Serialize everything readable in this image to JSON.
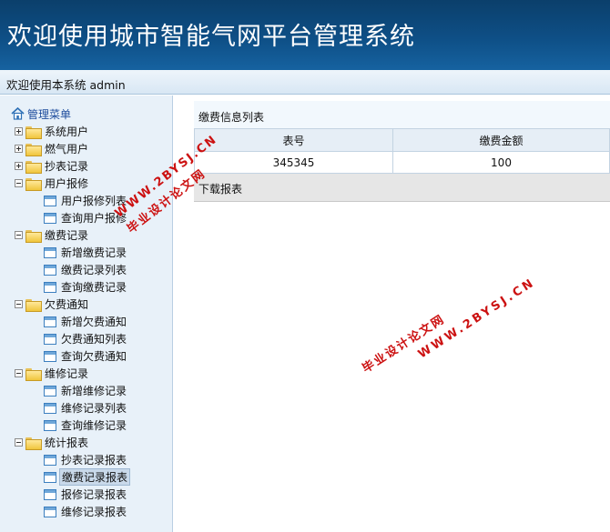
{
  "header": {
    "title": "欢迎使用城市智能气网平台管理系统"
  },
  "userbar": {
    "text": "欢迎使用本系统  admin"
  },
  "sidebar": {
    "root_label": "管理菜单",
    "items": [
      {
        "type": "group",
        "label": "系统用户",
        "expanded": false
      },
      {
        "type": "group",
        "label": "燃气用户",
        "expanded": false
      },
      {
        "type": "group",
        "label": "抄表记录",
        "expanded": false
      },
      {
        "type": "group",
        "label": "用户报修",
        "expanded": true
      },
      {
        "type": "leaf",
        "label": "用户报修列表"
      },
      {
        "type": "leaf",
        "label": "查询用户报修"
      },
      {
        "type": "group",
        "label": "缴费记录",
        "expanded": true
      },
      {
        "type": "leaf",
        "label": "新增缴费记录"
      },
      {
        "type": "leaf",
        "label": "缴费记录列表"
      },
      {
        "type": "leaf",
        "label": "查询缴费记录"
      },
      {
        "type": "group",
        "label": "欠费通知",
        "expanded": true
      },
      {
        "type": "leaf",
        "label": "新增欠费通知"
      },
      {
        "type": "leaf",
        "label": "欠费通知列表"
      },
      {
        "type": "leaf",
        "label": "查询欠费通知"
      },
      {
        "type": "group",
        "label": "维修记录",
        "expanded": true
      },
      {
        "type": "leaf",
        "label": "新增维修记录"
      },
      {
        "type": "leaf",
        "label": "维修记录列表"
      },
      {
        "type": "leaf",
        "label": "查询维修记录"
      },
      {
        "type": "group",
        "label": "统计报表",
        "expanded": true
      },
      {
        "type": "leaf",
        "label": "抄表记录报表"
      },
      {
        "type": "leaf",
        "label": "缴费记录报表",
        "selected": true
      },
      {
        "type": "leaf",
        "label": "报修记录报表"
      },
      {
        "type": "leaf",
        "label": "维修记录报表"
      }
    ]
  },
  "main": {
    "panel_title": "缴费信息列表",
    "table": {
      "columns": [
        "表号",
        "缴费金额"
      ],
      "rows": [
        [
          "345345",
          "100"
        ]
      ]
    },
    "download_label": "下载报表"
  },
  "watermarks": [
    {
      "site": "WWW.2BYSJ.CN",
      "name": "毕业设计论文网"
    },
    {
      "site": "WWW.2BYSJ.CN",
      "name": "毕业设计论文网"
    }
  ]
}
